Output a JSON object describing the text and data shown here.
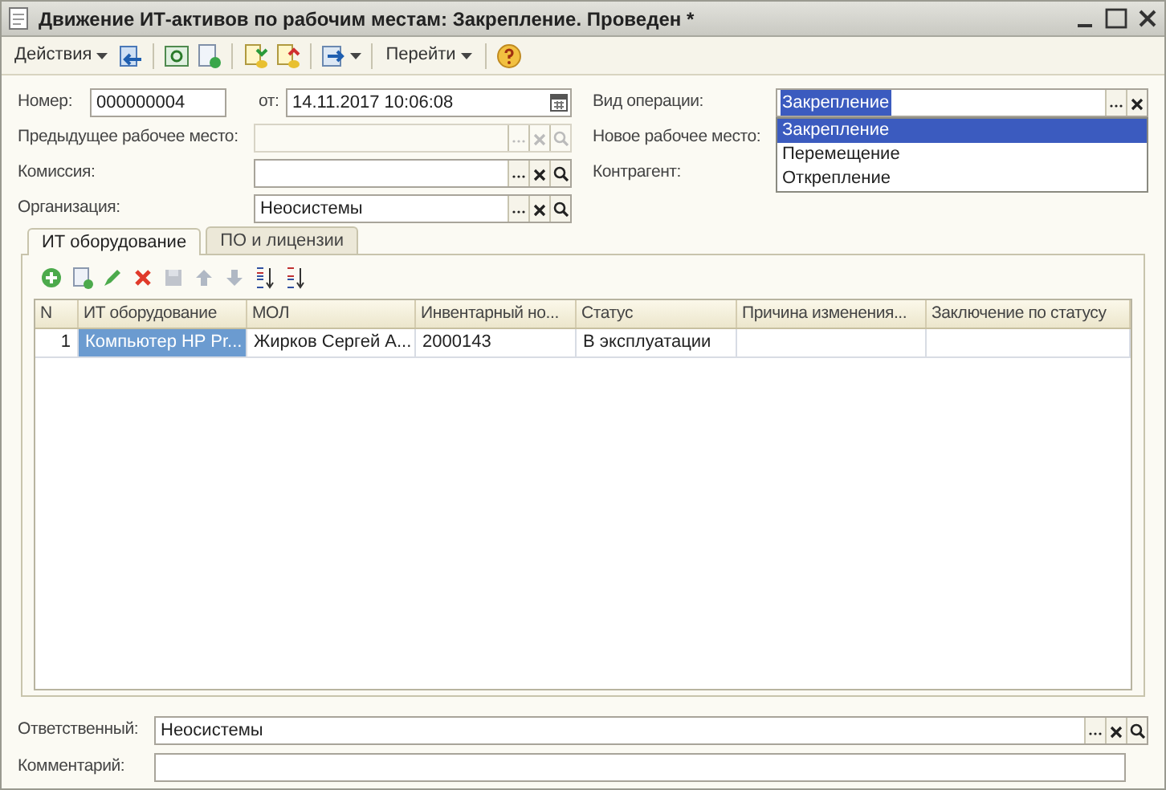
{
  "window": {
    "title": "Движение ИТ-активов по рабочим местам: Закрепление. Проведен *"
  },
  "toolbar": [
    {
      "kind": "menu",
      "label": "Действия"
    },
    {
      "kind": "icon"
    },
    {
      "kind": "sep"
    },
    {
      "kind": "icon"
    },
    {
      "kind": "icon"
    },
    {
      "kind": "sep"
    },
    {
      "kind": "icon"
    },
    {
      "kind": "icon"
    },
    {
      "kind": "sep"
    },
    {
      "kind": "iconmenu"
    },
    {
      "kind": "sep"
    },
    {
      "kind": "menu",
      "label": "Перейти"
    },
    {
      "kind": "sep"
    },
    {
      "kind": "icon"
    }
  ],
  "number": {
    "label": "Номер:",
    "value": "000000004"
  },
  "date": {
    "label": "от:",
    "value": "14.11.2017 10:06:08"
  },
  "left_fields": [
    {
      "label": "Предыдущее рабочее место:",
      "disabled": true
    },
    {
      "label": "Комиссия:",
      "disabled": false
    },
    {
      "label": "Организация:",
      "value": "Неосистемы",
      "disabled": false
    }
  ],
  "operation": {
    "label": "Вид операции:",
    "value": "Закрепление",
    "options": [
      {
        "label": "Закрепление",
        "selected": true
      },
      {
        "label": "Перемещение",
        "selected": false
      },
      {
        "label": "Открепление",
        "selected": false
      }
    ]
  },
  "right_labels": [
    "Новое рабочее место:",
    "Контрагент:"
  ],
  "tabs": [
    {
      "label": "ИТ оборудование",
      "selected": true
    },
    {
      "label": "ПО и лицензии",
      "selected": false
    }
  ],
  "table": {
    "columns": [
      "N",
      "ИТ оборудование",
      "МОЛ",
      "Инвентарный но...",
      "Статус",
      "Причина изменения...",
      "Заключение по статусу"
    ],
    "rows": [
      {
        "cells": [
          "1",
          "Компьютер HP Pr...",
          "Жирков Сергей А...",
          "2000143",
          "В эксплуатации",
          "",
          ""
        ],
        "selected": true
      }
    ]
  },
  "responsible": {
    "label": "Ответственный:",
    "value": "Неосистемы"
  },
  "comment": {
    "label": "Комментарий:"
  }
}
